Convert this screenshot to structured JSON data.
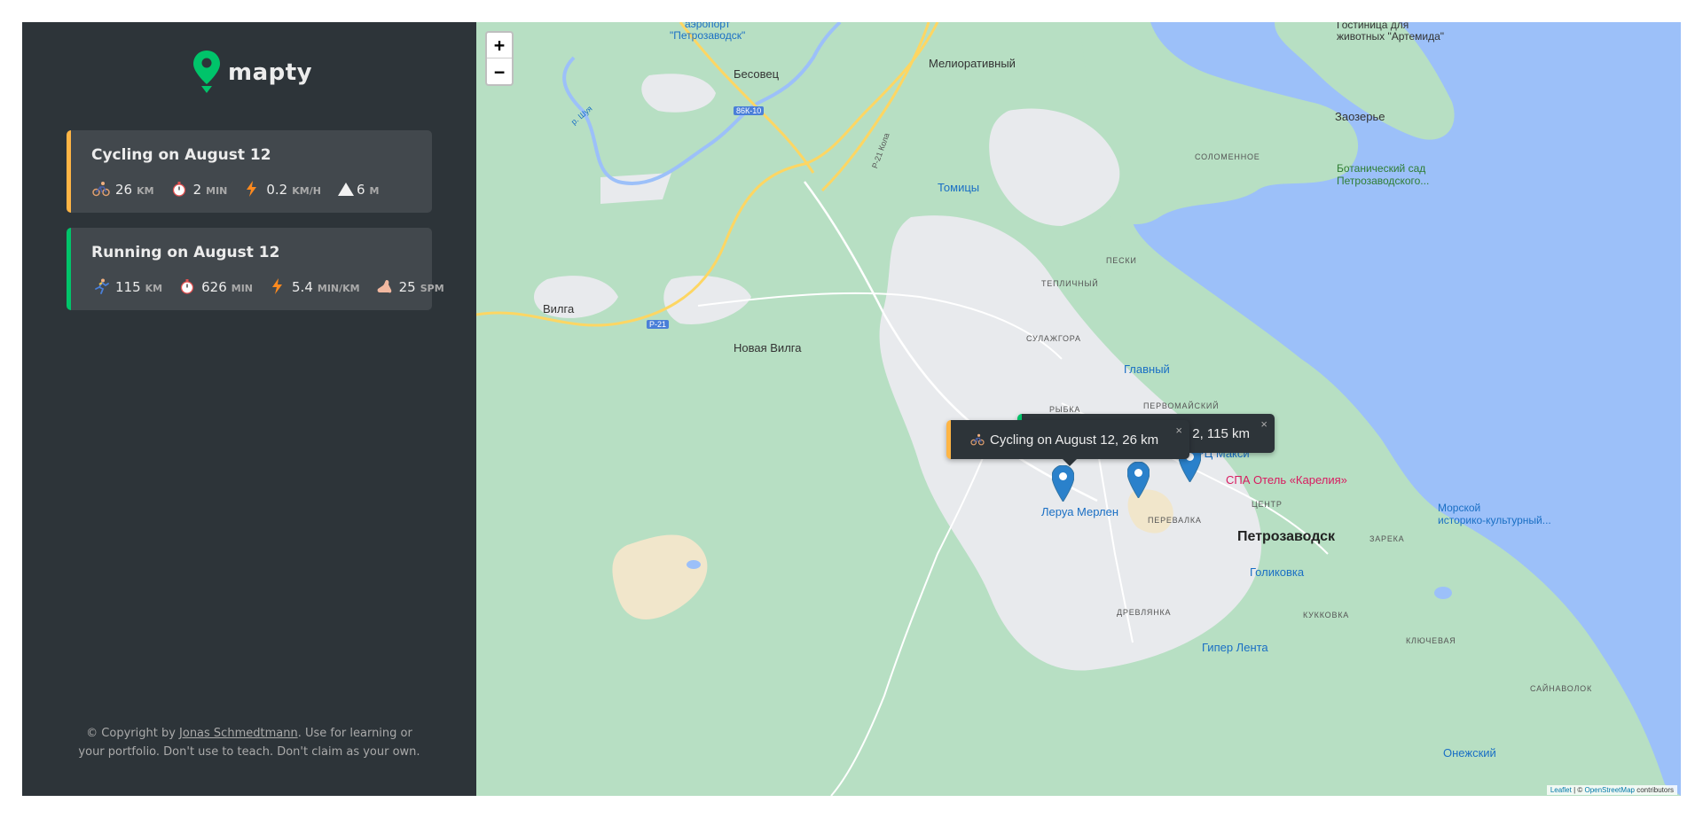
{
  "app": {
    "name": "mapty"
  },
  "workouts": [
    {
      "type": "cycling",
      "title": "Cycling on August 12",
      "distance": "26",
      "distance_unit": "km",
      "duration": "2",
      "duration_unit": "min",
      "speed": "0.2",
      "speed_unit": "km/h",
      "elevation": "6",
      "elevation_unit": "m",
      "color": "#ffb545"
    },
    {
      "type": "running",
      "title": "Running on August 12",
      "distance": "115",
      "distance_unit": "km",
      "duration": "626",
      "duration_unit": "min",
      "pace": "5.4",
      "pace_unit": "min/km",
      "cadence": "25",
      "cadence_unit": "spm",
      "color": "#00c46a"
    }
  ],
  "copyright": {
    "prefix": "© Copyright by",
    "author": "Jonas Schmedtmann",
    "suffix": ". Use for learning or your portfolio. Don't use to teach. Don't claim as your own."
  },
  "map": {
    "zoom_in": "+",
    "zoom_out": "−",
    "popups": [
      {
        "text": "Cycling on August 12, 26 km",
        "icon": "cyclist-icon",
        "close": "×"
      },
      {
        "text": "2, 115 km",
        "close": "×"
      }
    ],
    "places": {
      "airport": "аэропорт\n\"Петрозаводск\"",
      "besovets": "Бесовец",
      "meliorativny": "Мелиоративный",
      "hotel": "Гостиница для\nживотных \"Артемида\"",
      "zaozerye": "Заозерье",
      "solomennoe": "СОЛОМЕННОЕ",
      "botanic": "Ботанический сад\nПетрозаводского...",
      "tomitsy": "Томицы",
      "peski": "ПЕСКИ",
      "teplichny": "ТЕПЛИЧНЫЙ",
      "vilga": "Вилга",
      "novaya_vilga": "Новая Вилга",
      "sulazhgora": "СУЛАЖГОРА",
      "glavny": "Главный",
      "ryboka": "РЫБКА",
      "pervomaysky": "ПЕРВОМАЙСКИЙ",
      "trts_maxi": "ТРЦ Макси",
      "spa": "СПА Отель «Карелия»",
      "tsentr": "ЦЕНТР",
      "leroy": "Леруа Мерлен",
      "perevalka": "ПЕРЕВАЛКА",
      "petrozavodsk": "Петрозаводск",
      "zareka": "ЗАРЕКА",
      "museum": "Морской\nисторико-культурный...",
      "golikovka": "Голиковка",
      "drevlyanka": "ДРЕВЛЯНКА",
      "kukkovka": "КУККОВКА",
      "giper_lenta": "Гипер Лента",
      "klyuchevaya": "КЛЮЧЕВАЯ",
      "saynavolok": "САЙНАВОЛОК",
      "onezhsky": "Онежский",
      "river_shuya": "р. Шуя",
      "road_86k10": "86К-10",
      "road_r21": "Р-21",
      "road_r21kola": "Р-21 Кола"
    },
    "attribution": {
      "leaflet": "Leaflet",
      "sep": " | © ",
      "osm": "OpenStreetMap",
      "suffix": " contributors"
    },
    "colors": {
      "water": "#9cc0f9",
      "land": "#b7dfc3",
      "urban": "#e8eaed",
      "road_major": "#fdd663",
      "marker": "#2a81cb"
    }
  }
}
